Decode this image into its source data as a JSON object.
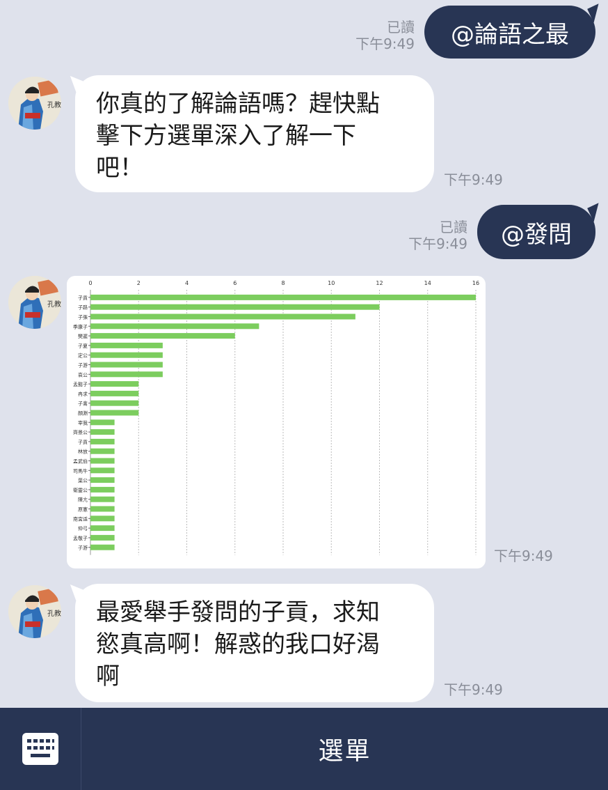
{
  "messages": {
    "out1": {
      "text": "@論語之最",
      "read": "已讀",
      "time": "下午9:49"
    },
    "in1": {
      "line1": "你真的了解論語嗎？趕快點",
      "line2": "擊下方選單深入了解一下",
      "line3": "吧！",
      "time": "下午9:49"
    },
    "out2": {
      "text": "@發問",
      "read": "已讀",
      "time": "下午9:49"
    },
    "chart_msg": {
      "time": "下午9:49"
    },
    "in2": {
      "line1": "最愛舉手發問的子貢，求知",
      "line2": "慾真高啊！解惑的我口好渴",
      "line3": "啊",
      "time": "下午9:49"
    }
  },
  "avatar": {
    "label": "孔教授"
  },
  "bottom": {
    "menu_label": "選單",
    "keyboard_icon": "keyboard-icon"
  },
  "colors": {
    "bar": "#7ccd5e",
    "bubble_out": "#283554",
    "background": "#dfe2ec"
  },
  "chart_data": {
    "type": "bar",
    "orientation": "horizontal",
    "title": "",
    "xlabel": "",
    "ylabel": "",
    "xlim": [
      0,
      16
    ],
    "xticks": [
      0,
      2,
      4,
      6,
      8,
      10,
      12,
      14,
      16
    ],
    "grid": "vertical dashed",
    "categories": [
      "子貢",
      "子路",
      "子張",
      "季康子",
      "樊遲",
      "子夏",
      "定公",
      "子游",
      "哀公",
      "孟懿子",
      "冉求",
      "子禽",
      "顏淵",
      "宰我",
      "齊景公",
      "子貢2",
      "林放",
      "孟武伯",
      "司馬牛",
      "葉公",
      "衛靈公",
      "陳亢",
      "原憲",
      "南宮适",
      "仲弓",
      "孟敬子",
      "子游2"
    ],
    "values": [
      16,
      12,
      11,
      7,
      6,
      3,
      3,
      3,
      3,
      2,
      2,
      2,
      2,
      1,
      1,
      1,
      1,
      1,
      1,
      1,
      1,
      1,
      1,
      1,
      1,
      1,
      1
    ]
  }
}
